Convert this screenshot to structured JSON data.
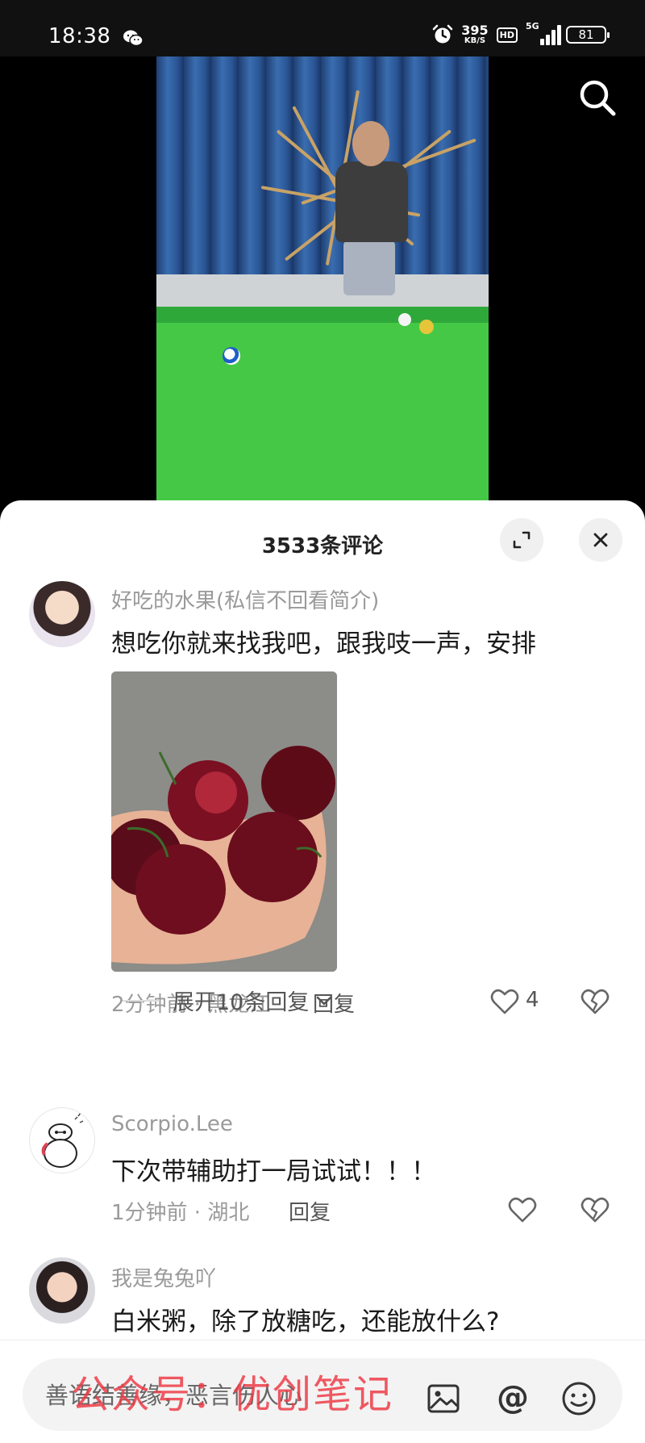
{
  "status_bar": {
    "time": "18:38",
    "net_speed": "395",
    "net_unit": "KB/S",
    "hd": "HD",
    "network": "5G",
    "battery": "81"
  },
  "comments_panel": {
    "title": "3533条评论"
  },
  "comments": [
    {
      "username": "好吃的水果(私信不回看简介)",
      "text": "想吃你就来找我吧，跟我吱一声，安排",
      "meta": "2分钟前 · 黑龙江",
      "reply_label": "回复",
      "likes": "4",
      "expand_label": "展开10条回复"
    },
    {
      "username": "Scorpio.Lee",
      "text": "下次带辅助打一局试试！！！",
      "meta": "1分钟前 · 湖北",
      "reply_label": "回复"
    },
    {
      "username": "我是兔兔吖",
      "text": "白米粥，除了放糖吃，还能放什么?"
    }
  ],
  "input_bar": {
    "placeholder": "善语结善缘，恶言伤人心",
    "watermark": "公众号：优创笔记"
  },
  "colors": {
    "felt": "#45c846",
    "curtain": "#2a5594",
    "watermark": "#ec3c46",
    "meta_gray": "#9a9a9a"
  },
  "icons": [
    "wechat-icon",
    "alarm-icon",
    "search-icon",
    "expand-icon",
    "close-icon",
    "heart-icon",
    "broken-heart-icon",
    "chevron-down-icon",
    "image-icon",
    "at-icon",
    "emoji-icon"
  ]
}
